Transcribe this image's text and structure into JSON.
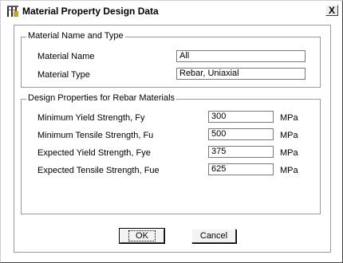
{
  "window": {
    "title": "Material Property Design Data",
    "close_label": "X"
  },
  "material_group": {
    "title": "Material Name and Type",
    "name_label": "Material Name",
    "name_value": "All",
    "type_label": "Material Type",
    "type_value": "Rebar, Uniaxial"
  },
  "rebar_group": {
    "title": "Design Properties for Rebar Materials",
    "rows": [
      {
        "label": "Minimum Yield Strength, Fy",
        "value": "300",
        "unit": "MPa"
      },
      {
        "label": "Minimum Tensile Strength, Fu",
        "value": "500",
        "unit": "MPa"
      },
      {
        "label": "Expected Yield Strength, Fye",
        "value": "375",
        "unit": "MPa"
      },
      {
        "label": "Expected Tensile Strength, Fue",
        "value": "625",
        "unit": "MPa"
      }
    ]
  },
  "buttons": {
    "ok": "OK",
    "cancel": "Cancel"
  },
  "icons": {
    "app": "structure-app-icon",
    "close": "close-icon"
  }
}
